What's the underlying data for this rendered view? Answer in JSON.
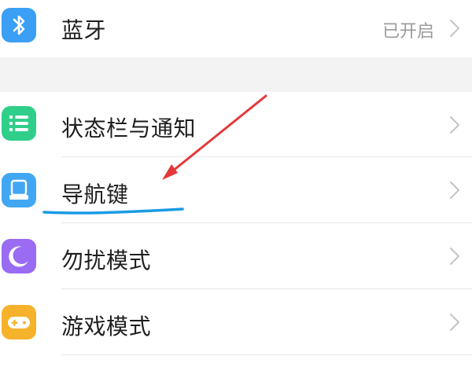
{
  "settings": {
    "items": [
      {
        "label": "蓝牙",
        "status": "已开启",
        "icon": "bluetooth-icon",
        "color": "#3a9ff5"
      },
      {
        "label": "状态栏与通知",
        "icon": "status-bar-icon",
        "color": "#2fcf8a"
      },
      {
        "label": "导航键",
        "icon": "navigation-keys-icon",
        "color": "#42a7f3"
      },
      {
        "label": "勿扰模式",
        "icon": "moon-icon",
        "color": "#9a6cf3"
      },
      {
        "label": "游戏模式",
        "icon": "gamepad-icon",
        "color": "#f6b22a"
      }
    ]
  },
  "colors": {
    "annotation_arrow": "#e4383a",
    "annotation_underline": "#1a9be4",
    "section_gap": "#f3f3f3"
  }
}
